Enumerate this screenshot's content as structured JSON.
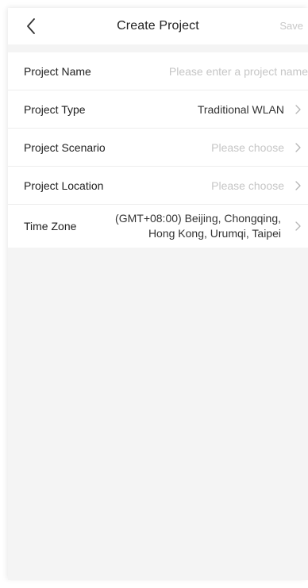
{
  "header": {
    "title": "Create Project",
    "save_label": "Save"
  },
  "form": {
    "project_name": {
      "label": "Project Name",
      "placeholder": "Please enter a project name",
      "value": ""
    },
    "project_type": {
      "label": "Project Type",
      "value": "Traditional WLAN"
    },
    "project_scenario": {
      "label": "Project Scenario",
      "placeholder": "Please choose"
    },
    "project_location": {
      "label": "Project Location",
      "placeholder": "Please choose"
    },
    "time_zone": {
      "label": "Time Zone",
      "value_line1": "(GMT+08:00) Beijing, Chongqing,",
      "value_line2": "Hong Kong, Urumqi, Taipei"
    }
  },
  "icons": {
    "back": "chevron-left-icon",
    "row_arrow": "chevron-right-icon"
  },
  "colors": {
    "background": "#f4f4f4",
    "placeholder": "#c6c6c6",
    "disabled_save": "#c8c8c8",
    "text": "#1f1f1f"
  }
}
